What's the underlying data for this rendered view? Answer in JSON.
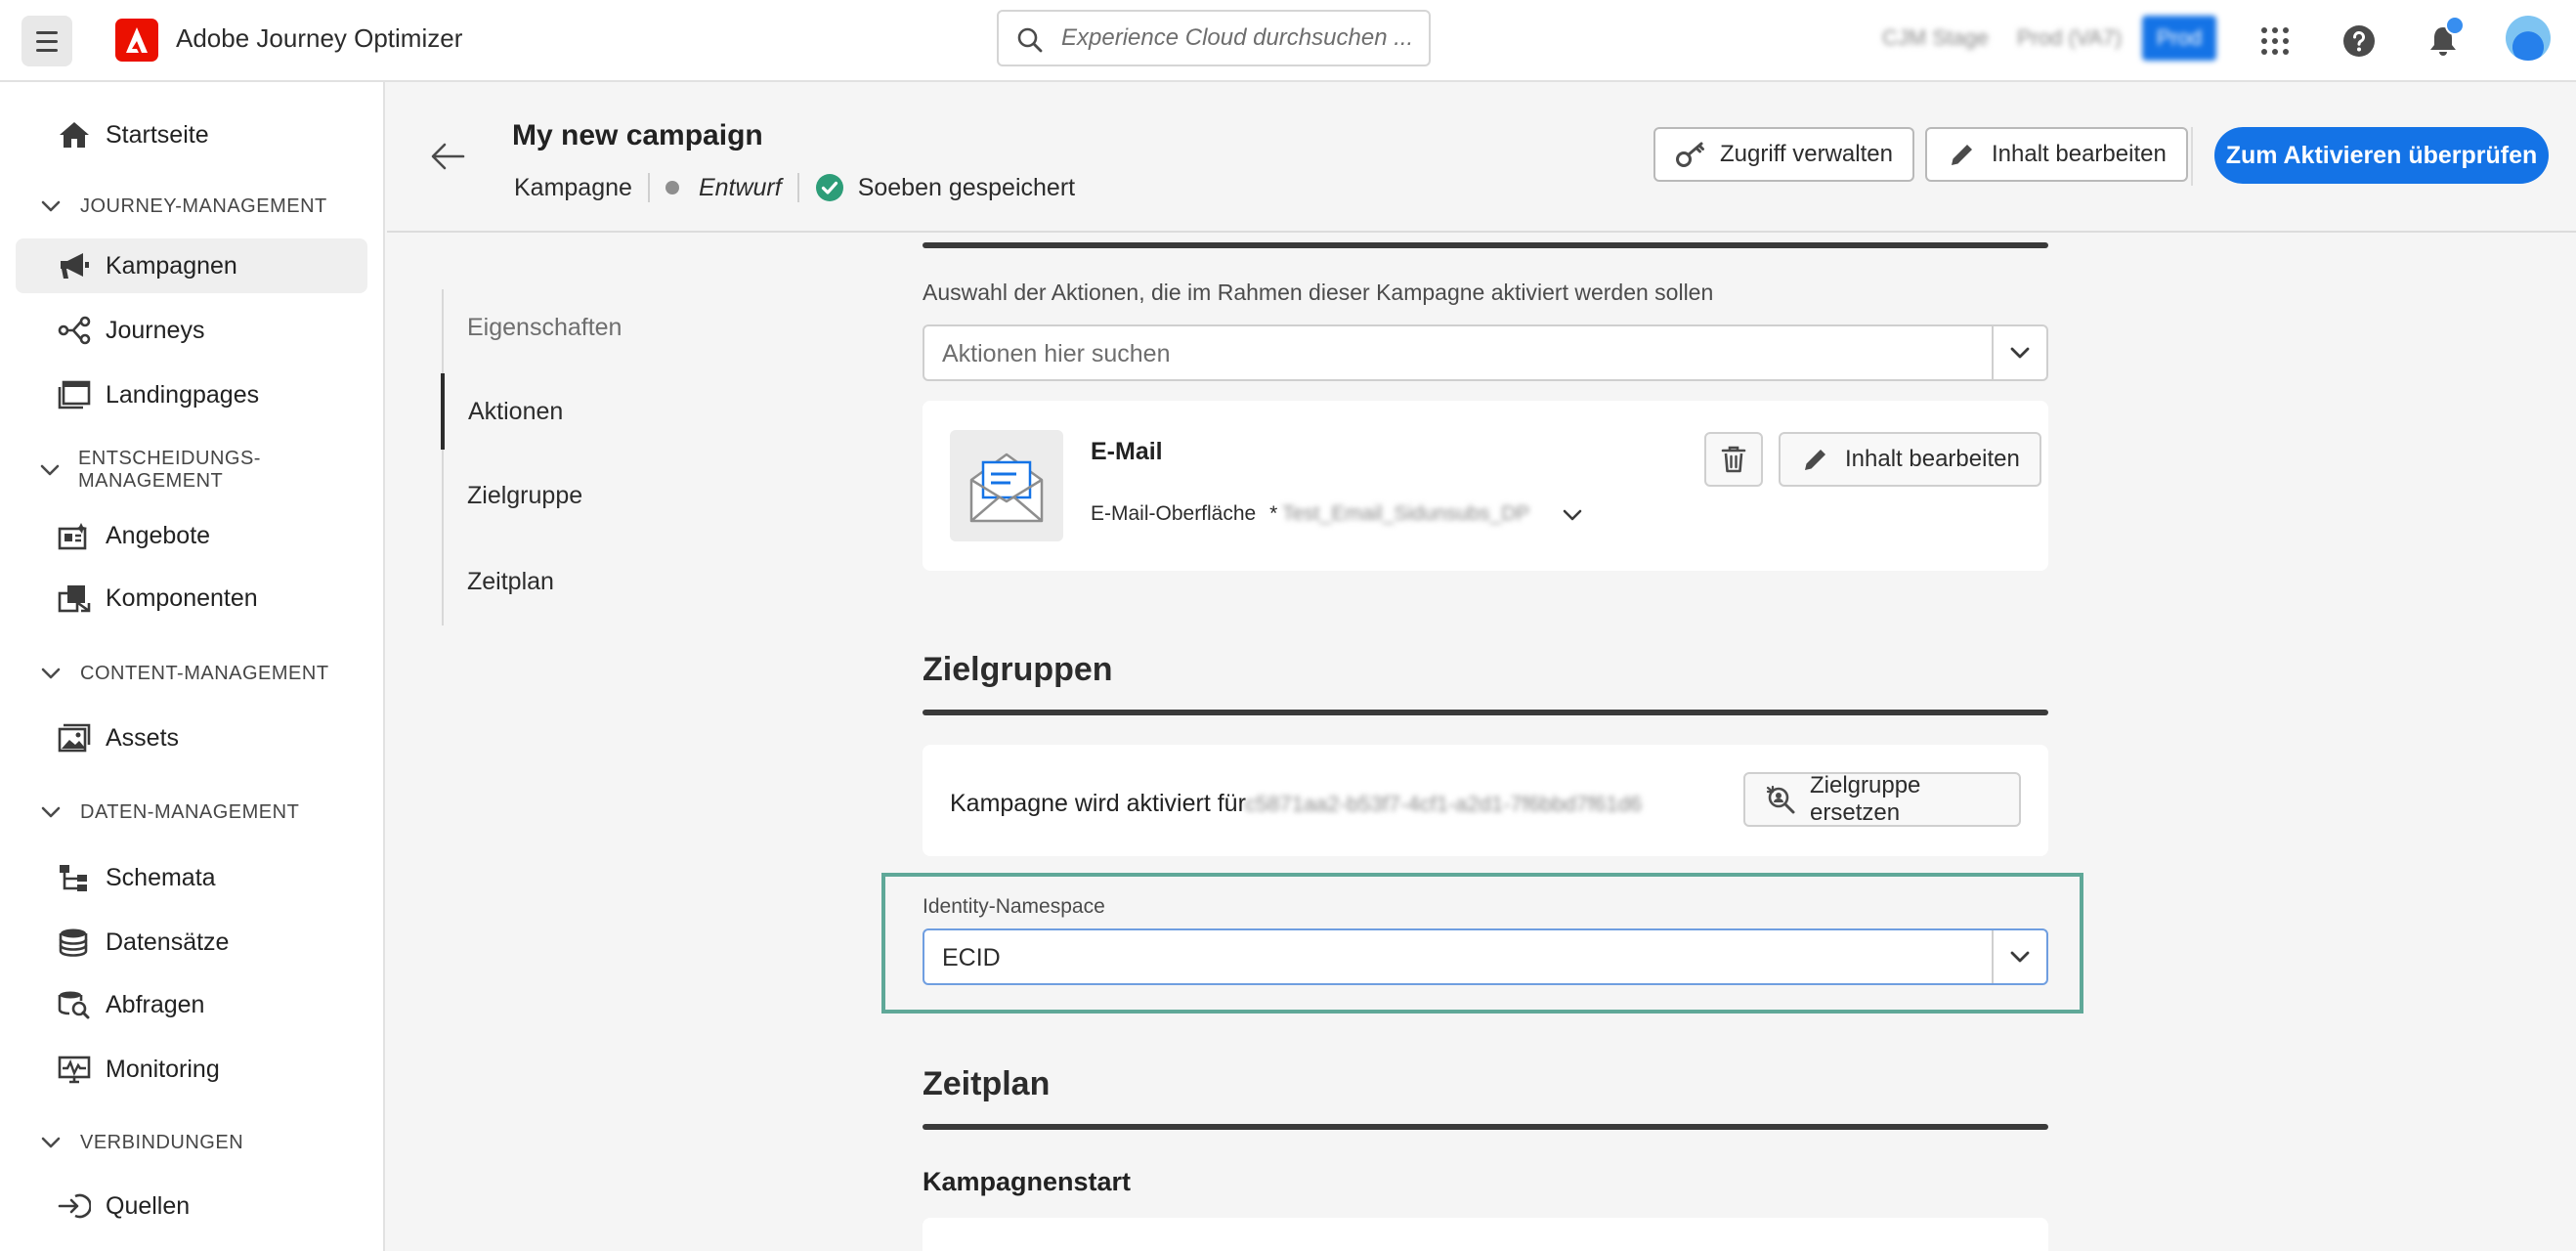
{
  "app": {
    "name": "Adobe Journey Optimizer",
    "search_placeholder": "Experience Cloud durchsuchen ...",
    "org_name": "CJM Stage",
    "sandbox": "Prod (VA7)",
    "env_badge": "Prod"
  },
  "sidebar": {
    "home": "Startseite",
    "sections": [
      {
        "label": "JOURNEY-MANAGEMENT",
        "items": [
          "Kampagnen",
          "Journeys",
          "Landingpages"
        ]
      },
      {
        "label": "ENTSCHEIDUNGS- MANAGEMENT",
        "items": [
          "Angebote",
          "Komponenten"
        ]
      },
      {
        "label": "CONTENT-MANAGEMENT",
        "items": [
          "Assets"
        ]
      },
      {
        "label": "DATEN-MANAGEMENT",
        "items": [
          "Schemata",
          "Datensätze",
          "Abfragen",
          "Monitoring"
        ]
      },
      {
        "label": "VERBINDUNGEN",
        "items": [
          "Quellen"
        ]
      }
    ],
    "active_item": "Kampagnen"
  },
  "header": {
    "title": "My new campaign",
    "type": "Kampagne",
    "status": "Entwurf",
    "saved": "Soeben gespeichert",
    "manage_access": "Zugriff verwalten",
    "edit_content": "Inhalt bearbeiten",
    "review_activate": "Zum Aktivieren überprüfen"
  },
  "steps": [
    "Eigenschaften",
    "Aktionen",
    "Zielgruppe",
    "Zeitplan"
  ],
  "actions": {
    "label": "Auswahl der Aktionen, die im Rahmen dieser Kampagne aktiviert werden sollen",
    "search_placeholder": "Aktionen hier suchen",
    "email": {
      "title": "E-Mail",
      "surface_label": "E-Mail-Oberfläche",
      "required_mark": "*",
      "surface_value": "Test_Email_Sidunsubs_DP",
      "edit_content": "Inhalt bearbeiten"
    }
  },
  "audience": {
    "title": "Zielgruppen",
    "activated_for": "Kampagne wird aktiviert für",
    "audience_id": "c5871aa2-b53f7-4cf1-a2d1-7f6bbd7f61d6",
    "replace": "Zielgruppe ersetzen",
    "namespace_label": "Identity-Namespace",
    "namespace_value": "ECID"
  },
  "schedule": {
    "title": "Zeitplan",
    "start": "Kampagnenstart"
  },
  "colors": {
    "accent": "#1473e6",
    "highlight": "#5fa898",
    "saved_check": "#2d9d78"
  }
}
